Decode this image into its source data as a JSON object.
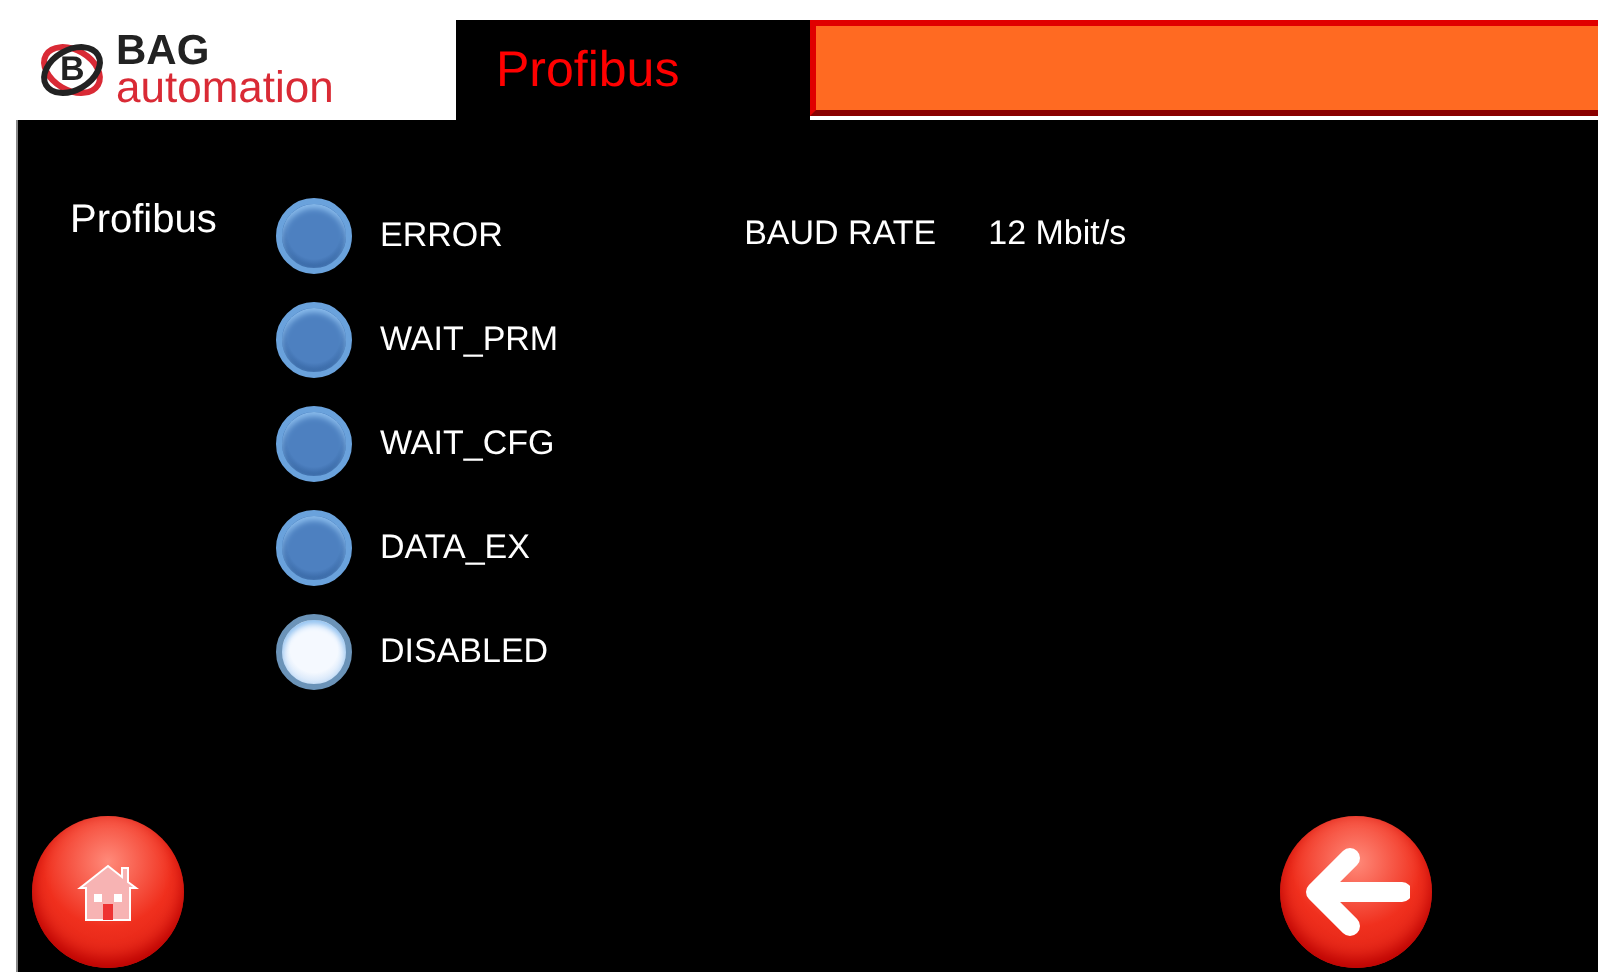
{
  "logo": {
    "mark": "B",
    "brand": "BAG",
    "sub": "automation"
  },
  "header": {
    "title": "Profibus"
  },
  "section": {
    "label": "Profibus"
  },
  "states": [
    {
      "label": "ERROR",
      "on": false
    },
    {
      "label": "WAIT_PRM",
      "on": false
    },
    {
      "label": "WAIT_CFG",
      "on": false
    },
    {
      "label": "DATA_EX",
      "on": false
    },
    {
      "label": "DISABLED",
      "on": true
    }
  ],
  "baud": {
    "label": "BAUD RATE",
    "value": "12 Mbit/s"
  }
}
